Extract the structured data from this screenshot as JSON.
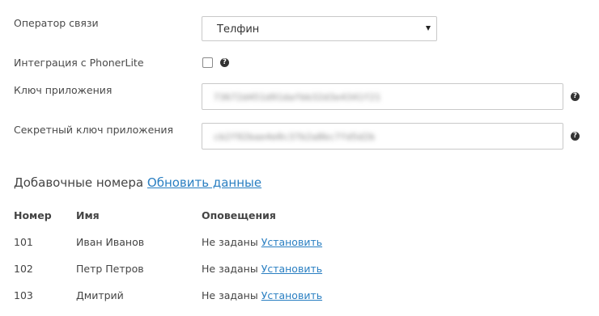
{
  "form": {
    "operator_label": "Оператор связи",
    "operator_value": "Телфин",
    "phonerlite_label": "Интеграция с PhonerLite",
    "app_key_label": "Ключ приложения",
    "app_key_value": "73672d451d91dafbb32d3e4341f21",
    "secret_key_label": "Секретный ключ приложения",
    "secret_key_value": "cb2f92bae4e0c37b2a8bc7fd5d2b",
    "help_glyph": "?"
  },
  "extensions": {
    "title": "Добавочные номера",
    "refresh_link": "Обновить данные",
    "columns": [
      "Номер",
      "Имя",
      "Оповещения"
    ],
    "rows": [
      {
        "number": "101",
        "name": "Иван Иванов",
        "notify": "Не заданы",
        "action": "Установить"
      },
      {
        "number": "102",
        "name": "Петр Петров",
        "notify": "Не заданы",
        "action": "Установить"
      },
      {
        "number": "103",
        "name": "Дмитрий",
        "notify": "Не заданы",
        "action": "Установить"
      }
    ]
  },
  "colors": {
    "link": "#2a7fc2",
    "text": "#444444",
    "border": "#c9c9c9"
  }
}
